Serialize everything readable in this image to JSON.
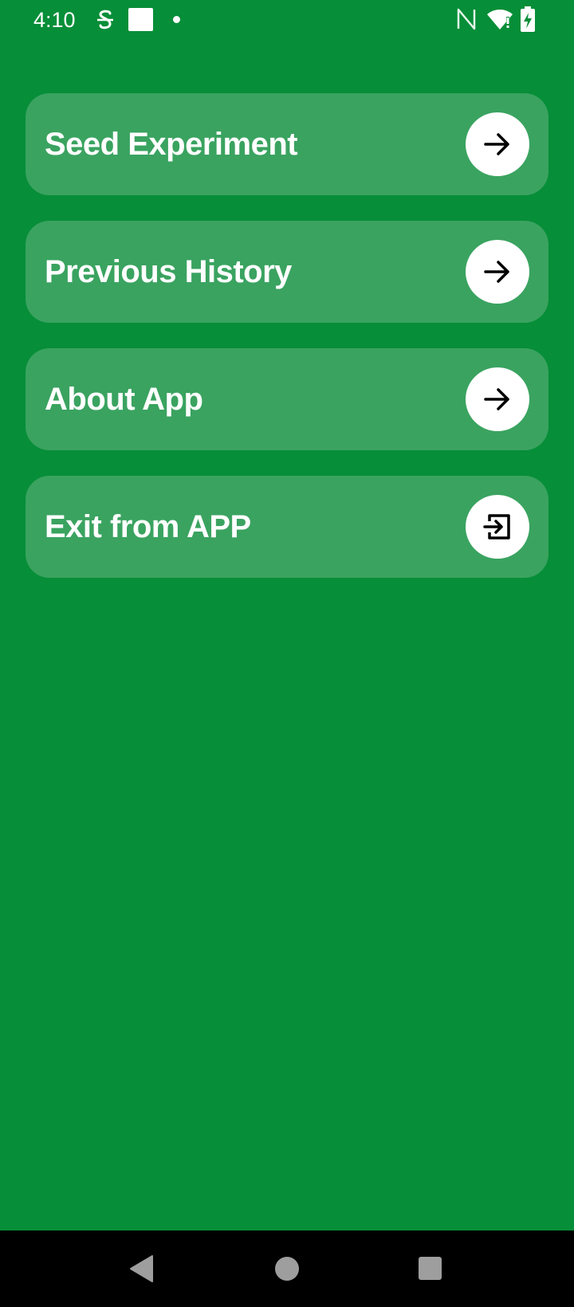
{
  "status_bar": {
    "time": "4:10",
    "icons": [
      "app-notification-icon",
      "square-notification-icon",
      "dot-icon",
      "nfc-icon",
      "wifi-alert-icon",
      "battery-charging-icon"
    ]
  },
  "menu": {
    "items": [
      {
        "label": "Seed Experiment",
        "icon": "arrow-right-icon"
      },
      {
        "label": "Previous History",
        "icon": "arrow-right-icon"
      },
      {
        "label": "About App",
        "icon": "arrow-right-icon"
      },
      {
        "label": "Exit from APP",
        "icon": "exit-icon"
      }
    ]
  },
  "nav_bar": {
    "icons": [
      "back-icon",
      "home-icon",
      "recents-icon"
    ]
  },
  "colors": {
    "background": "#078E38",
    "card": "#3AA360",
    "action_circle": "#FFFFFF",
    "text": "#FFFFFF",
    "nav_bar": "#000000"
  }
}
